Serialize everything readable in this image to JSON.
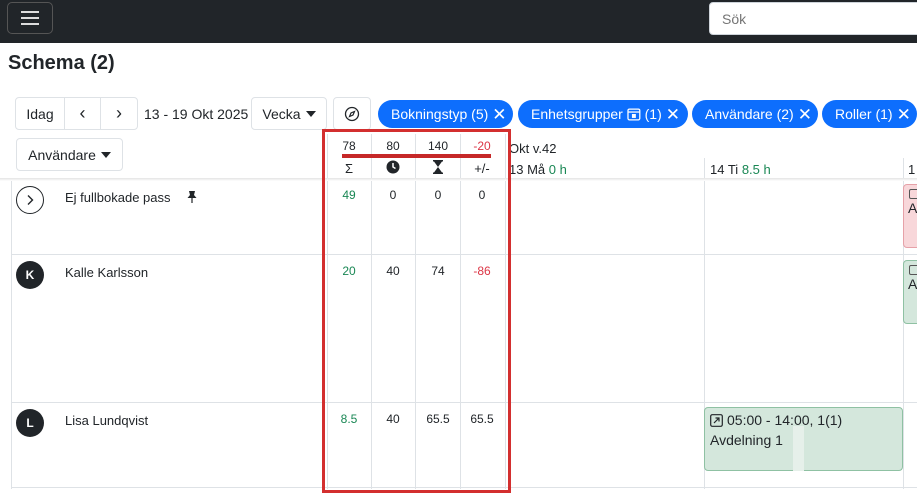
{
  "app": {
    "search_placeholder": "Sök",
    "title": "Schema (2)"
  },
  "toolbar": {
    "today": "Idag",
    "prev": "‹",
    "next": "›",
    "date_range": "13 - 19 Okt 2025",
    "view": "Vecka",
    "group_by": "Användare"
  },
  "filters": [
    {
      "label": "Bokningstyp (5)"
    },
    {
      "label": "Enhetsgrupper",
      "count": "(1)"
    },
    {
      "label": "Användare (2)"
    },
    {
      "label": "Roller (1)"
    }
  ],
  "summary": {
    "totals": [
      "78",
      "80",
      "140",
      "-20"
    ],
    "symbols": [
      "Σ",
      "clock-icon",
      "hourglass-icon",
      "+/-"
    ]
  },
  "calendar": {
    "week": "Okt v.42",
    "days": [
      {
        "label": "13 Må",
        "hours": "0 h"
      },
      {
        "label": "14 Ti",
        "hours": "8.5 h"
      },
      {
        "label": "1",
        "hours": ""
      }
    ]
  },
  "rows": [
    {
      "avatar": "",
      "name": "Ej fullbokade pass",
      "values": [
        "49",
        "0",
        "0",
        "0"
      ]
    },
    {
      "avatar": "K",
      "name": "Kalle Karlsson",
      "values": [
        "20",
        "40",
        "74",
        "-86"
      ]
    },
    {
      "avatar": "L",
      "name": "Lisa Lundqvist",
      "values": [
        "8.5",
        "40",
        "65.5",
        "65.5"
      ]
    }
  ],
  "shift": {
    "time": "05:00 - 14:00, 1(1)",
    "department": "Avdelning 1"
  },
  "edge_cards": [
    "Av",
    "Av"
  ],
  "colors": {
    "chip": "#0d6efd",
    "highlight": "#d32f2f",
    "positive": "#198754",
    "negative": "#dc3545"
  }
}
